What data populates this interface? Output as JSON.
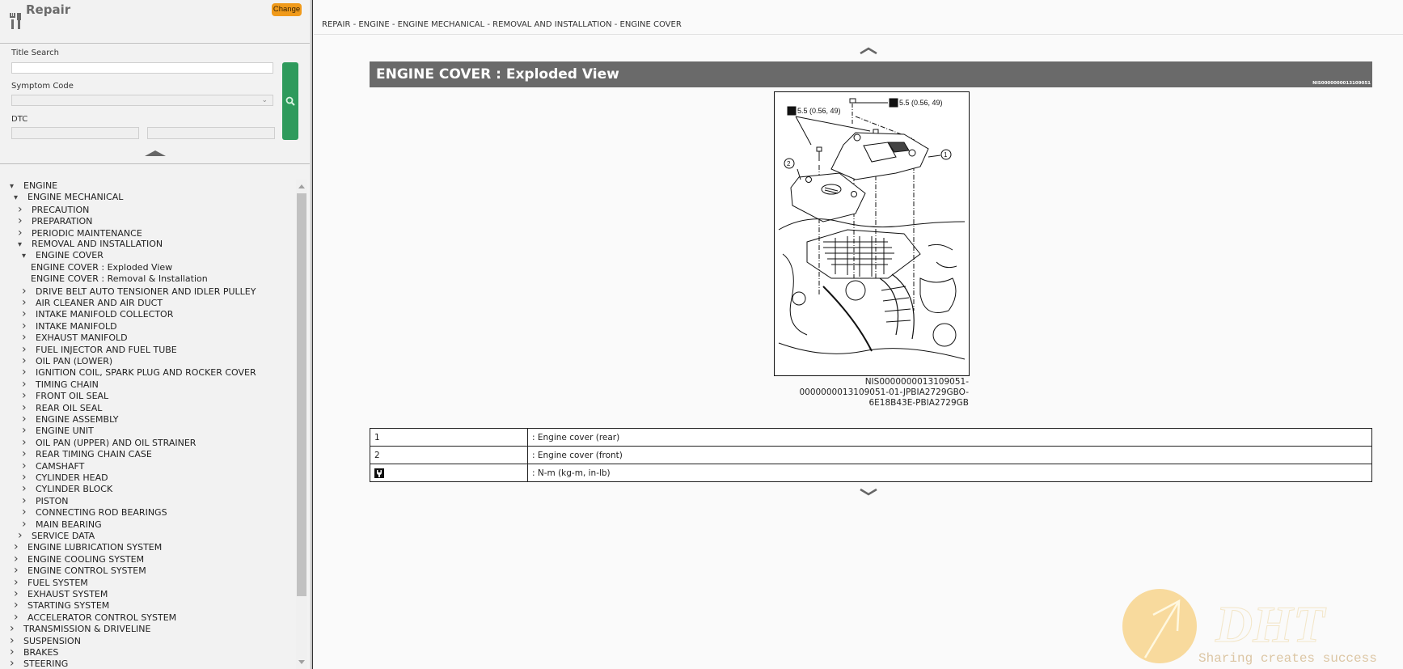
{
  "sidebar": {
    "title": "Repair",
    "change_label": "Change",
    "title_search_label": "Title Search",
    "title_search_value": "",
    "symptom_code_label": "Symptom Code",
    "symptom_code_value": "",
    "dtc_label": "DTC",
    "dtc_value_1": "",
    "dtc_value_2": "",
    "tree": [
      {
        "label": "ENGINE",
        "level": 0,
        "state": "expanded"
      },
      {
        "label": "ENGINE MECHANICAL",
        "level": 1,
        "state": "expanded"
      },
      {
        "label": "PRECAUTION",
        "level": 2,
        "state": "collapsed"
      },
      {
        "label": "PREPARATION",
        "level": 2,
        "state": "collapsed"
      },
      {
        "label": "PERIODIC MAINTENANCE",
        "level": 2,
        "state": "collapsed"
      },
      {
        "label": "REMOVAL AND INSTALLATION",
        "level": 2,
        "state": "expanded"
      },
      {
        "label": "ENGINE COVER",
        "level": 3,
        "state": "expanded"
      },
      {
        "label": "ENGINE COVER : Exploded View",
        "level": 4,
        "state": "leaf",
        "selected": true
      },
      {
        "label": "ENGINE COVER : Removal & Installation",
        "level": 4,
        "state": "leaf"
      },
      {
        "label": "DRIVE BELT AUTO TENSIONER AND IDLER PULLEY",
        "level": 3,
        "state": "collapsed"
      },
      {
        "label": "AIR CLEANER AND AIR DUCT",
        "level": 3,
        "state": "collapsed"
      },
      {
        "label": "INTAKE MANIFOLD COLLECTOR",
        "level": 3,
        "state": "collapsed"
      },
      {
        "label": "INTAKE MANIFOLD",
        "level": 3,
        "state": "collapsed"
      },
      {
        "label": "EXHAUST MANIFOLD",
        "level": 3,
        "state": "collapsed"
      },
      {
        "label": "FUEL INJECTOR AND FUEL TUBE",
        "level": 3,
        "state": "collapsed"
      },
      {
        "label": "OIL PAN (LOWER)",
        "level": 3,
        "state": "collapsed"
      },
      {
        "label": "IGNITION COIL, SPARK PLUG AND ROCKER COVER",
        "level": 3,
        "state": "collapsed"
      },
      {
        "label": "TIMING CHAIN",
        "level": 3,
        "state": "collapsed"
      },
      {
        "label": "FRONT OIL SEAL",
        "level": 3,
        "state": "collapsed"
      },
      {
        "label": "REAR OIL SEAL",
        "level": 3,
        "state": "collapsed"
      },
      {
        "label": "ENGINE ASSEMBLY",
        "level": 3,
        "state": "collapsed"
      },
      {
        "label": "ENGINE UNIT",
        "level": 3,
        "state": "collapsed"
      },
      {
        "label": "OIL PAN (UPPER) AND OIL STRAINER",
        "level": 3,
        "state": "collapsed"
      },
      {
        "label": "REAR TIMING CHAIN CASE",
        "level": 3,
        "state": "collapsed"
      },
      {
        "label": "CAMSHAFT",
        "level": 3,
        "state": "collapsed"
      },
      {
        "label": "CYLINDER HEAD",
        "level": 3,
        "state": "collapsed"
      },
      {
        "label": "CYLINDER BLOCK",
        "level": 3,
        "state": "collapsed"
      },
      {
        "label": "PISTON",
        "level": 3,
        "state": "collapsed"
      },
      {
        "label": "CONNECTING ROD BEARINGS",
        "level": 3,
        "state": "collapsed"
      },
      {
        "label": "MAIN BEARING",
        "level": 3,
        "state": "collapsed"
      },
      {
        "label": "SERVICE DATA",
        "level": 2,
        "state": "collapsed"
      },
      {
        "label": "ENGINE LUBRICATION SYSTEM",
        "level": 1,
        "state": "collapsed"
      },
      {
        "label": "ENGINE COOLING SYSTEM",
        "level": 1,
        "state": "collapsed"
      },
      {
        "label": "ENGINE CONTROL SYSTEM",
        "level": 1,
        "state": "collapsed"
      },
      {
        "label": "FUEL SYSTEM",
        "level": 1,
        "state": "collapsed"
      },
      {
        "label": "EXHAUST SYSTEM",
        "level": 1,
        "state": "collapsed"
      },
      {
        "label": "STARTING SYSTEM",
        "level": 1,
        "state": "collapsed"
      },
      {
        "label": "ACCELERATOR CONTROL SYSTEM",
        "level": 1,
        "state": "collapsed"
      },
      {
        "label": "TRANSMISSION & DRIVELINE",
        "level": 0,
        "state": "collapsed"
      },
      {
        "label": "SUSPENSION",
        "level": 0,
        "state": "collapsed"
      },
      {
        "label": "BRAKES",
        "level": 0,
        "state": "collapsed"
      },
      {
        "label": "STEERING",
        "level": 0,
        "state": "collapsed"
      }
    ]
  },
  "main": {
    "breadcrumb": "REPAIR - ENGINE - ENGINE MECHANICAL - REMOVAL AND INSTALLATION - ENGINE COVER",
    "heading": "ENGINE COVER : Exploded View",
    "heading_id": "NIS0000000013109051",
    "figure": {
      "torque_label_left": "5.5 (0.56, 49)",
      "torque_label_right": "5.5 (0.56, 49)",
      "callout_1": "1",
      "callout_2": "2"
    },
    "caption_lines": [
      "NIS0000000013109051-",
      "0000000013109051-01-JPBIA2729GBO-",
      "6E18B43E-PBIA2729GB"
    ],
    "legend": [
      {
        "key": "1",
        "value": ": Engine cover (rear)"
      },
      {
        "key": "2",
        "value": ": Engine cover (front)"
      },
      {
        "key_icon": "torque-wrench-icon",
        "value": ": N-m (kg-m, in-lb)"
      }
    ]
  },
  "watermark": {
    "brand": "DHT",
    "tagline": "Sharing creates success"
  },
  "colors": {
    "change_button": "#f09a1a",
    "search_button": "#2e9a5c",
    "heading_bar": "#6a6a6a"
  }
}
